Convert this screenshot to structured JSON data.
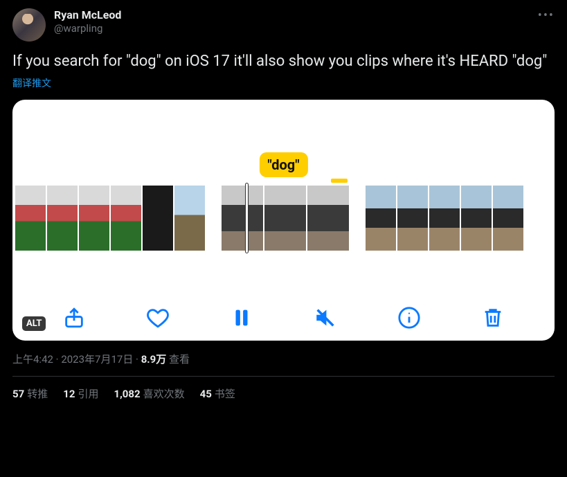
{
  "author": {
    "display_name": "Ryan McLeod",
    "handle": "@warpling"
  },
  "tweet_text": "If you search for \"dog\" on iOS 17 it'll also show you clips where it's HEARD \"dog\"",
  "translate_label": "翻译推文",
  "media": {
    "caption_token": "\"dog\"",
    "alt_badge": "ALT",
    "icons": {
      "share": "share-icon",
      "like": "heart-icon",
      "pause": "pause-icon",
      "mute": "speaker-muted-icon",
      "info": "info-icon",
      "trash": "trash-icon"
    }
  },
  "meta": {
    "time": "上午4:42",
    "separator": " · ",
    "date": "2023年7月17日",
    "views_count": "8.9万",
    "views_label": " 查看"
  },
  "stats": {
    "retweets": {
      "count": "57",
      "label": "转推"
    },
    "quotes": {
      "count": "12",
      "label": "引用"
    },
    "likes": {
      "count": "1,082",
      "label": "喜欢次数"
    },
    "bookmarks": {
      "count": "45",
      "label": "书签"
    }
  }
}
